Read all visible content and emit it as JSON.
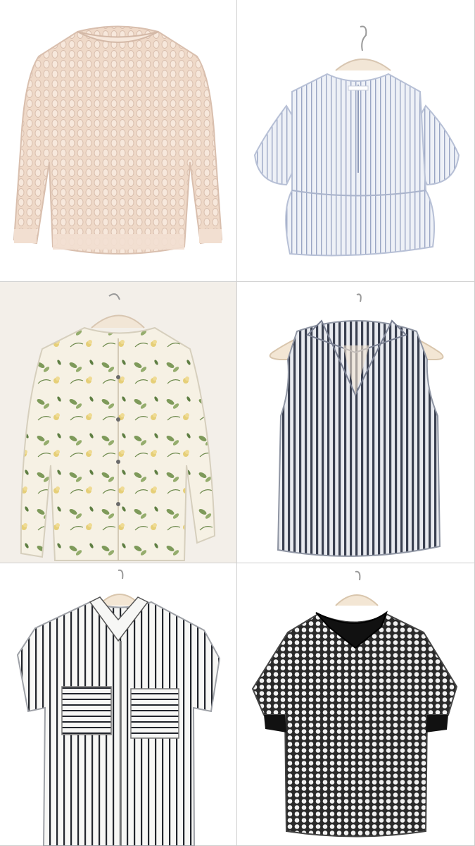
{
  "collage": {
    "items": [
      {
        "name": "cream-knit-sweater",
        "color": "#efd9c8"
      },
      {
        "name": "striped-puff-sleeve-peplum-top",
        "color": "#dfe5ef"
      },
      {
        "name": "floral-long-sleeve-blouse",
        "color": "#f4efe2"
      },
      {
        "name": "navy-striped-sleeveless-collar-top",
        "color": "#3a4050"
      },
      {
        "name": "black-white-striped-short-sleeve-shirt",
        "color": "#f3f3f1"
      },
      {
        "name": "black-dotted-top-with-black-collar",
        "color": "#2a2a2a"
      }
    ]
  }
}
